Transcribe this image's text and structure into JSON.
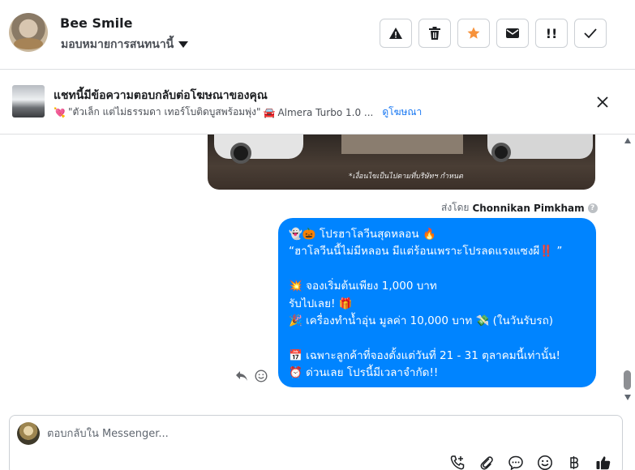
{
  "header": {
    "contact_name": "Bee Smile",
    "assign_label": "มอบหมายการสนทนานี้",
    "actions": [
      {
        "name": "spam-icon",
        "label": ""
      },
      {
        "name": "trash-icon",
        "label": ""
      },
      {
        "name": "star-icon",
        "label": "",
        "color": "#f7923b"
      },
      {
        "name": "mail-icon",
        "label": ""
      },
      {
        "name": "follow-up-icon",
        "label": "!!"
      },
      {
        "name": "check-icon",
        "label": ""
      }
    ]
  },
  "ad_banner": {
    "title": "แชทนี้มีข้อความตอบกลับต่อโฆษณาของคุณ",
    "ad_text": "\"ตัวเล็ก แต่ไม่ธรรมดา เทอร์โบติดบูสพร้อมพุ่ง\"",
    "car_text": "Almera Turbo 1.0 ...",
    "link_label": "ดูโฆษณา"
  },
  "conversation": {
    "image_note": "*เงื่อนไขเป็นไปตามที่บริษัทฯ กำหนด",
    "sent_by_prefix": "ส่งโดย",
    "sent_by_name": "Chonnikan Pimkham",
    "message_lines": [
      "👻🎃 โปรฮาโลวีนสุดหลอน 🔥",
      "“ฮาโลวีนนี้ไม่มีหลอน มีแต่ร้อนเพราะโปรลดแรงแซงผี‼️ ”",
      "",
      "💥 จองเริ่มต้นเพียง 1,000 บาท",
      "รับไปเลย! 🎁",
      "🎉 เครื่องทำน้ำอุ่น มูลค่า 10,000 บาท 💸 (ในวันรับรถ)",
      "",
      "📅 เฉพาะลูกค้าที่จองตั้งแต่วันที่ 21 - 31 ตุลาคมนี้เท่านั้น!",
      "⏰ ด่วนเลย โปรนี้มีเวลาจำกัด!!"
    ]
  },
  "composer": {
    "placeholder": "ตอบกลับใน Messenger..."
  },
  "colors": {
    "bubble": "#0084ff",
    "link": "#1877f2",
    "star": "#f7923b"
  }
}
